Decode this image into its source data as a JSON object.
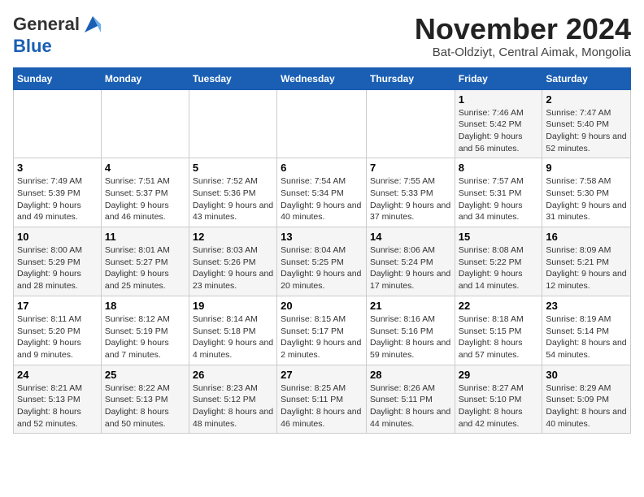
{
  "header": {
    "logo_line1": "General",
    "logo_line2": "Blue",
    "month": "November 2024",
    "location": "Bat-Oldziyt, Central Aimak, Mongolia"
  },
  "weekdays": [
    "Sunday",
    "Monday",
    "Tuesday",
    "Wednesday",
    "Thursday",
    "Friday",
    "Saturday"
  ],
  "weeks": [
    [
      {
        "day": "",
        "detail": ""
      },
      {
        "day": "",
        "detail": ""
      },
      {
        "day": "",
        "detail": ""
      },
      {
        "day": "",
        "detail": ""
      },
      {
        "day": "",
        "detail": ""
      },
      {
        "day": "1",
        "detail": "Sunrise: 7:46 AM\nSunset: 5:42 PM\nDaylight: 9 hours and 56 minutes."
      },
      {
        "day": "2",
        "detail": "Sunrise: 7:47 AM\nSunset: 5:40 PM\nDaylight: 9 hours and 52 minutes."
      }
    ],
    [
      {
        "day": "3",
        "detail": "Sunrise: 7:49 AM\nSunset: 5:39 PM\nDaylight: 9 hours and 49 minutes."
      },
      {
        "day": "4",
        "detail": "Sunrise: 7:51 AM\nSunset: 5:37 PM\nDaylight: 9 hours and 46 minutes."
      },
      {
        "day": "5",
        "detail": "Sunrise: 7:52 AM\nSunset: 5:36 PM\nDaylight: 9 hours and 43 minutes."
      },
      {
        "day": "6",
        "detail": "Sunrise: 7:54 AM\nSunset: 5:34 PM\nDaylight: 9 hours and 40 minutes."
      },
      {
        "day": "7",
        "detail": "Sunrise: 7:55 AM\nSunset: 5:33 PM\nDaylight: 9 hours and 37 minutes."
      },
      {
        "day": "8",
        "detail": "Sunrise: 7:57 AM\nSunset: 5:31 PM\nDaylight: 9 hours and 34 minutes."
      },
      {
        "day": "9",
        "detail": "Sunrise: 7:58 AM\nSunset: 5:30 PM\nDaylight: 9 hours and 31 minutes."
      }
    ],
    [
      {
        "day": "10",
        "detail": "Sunrise: 8:00 AM\nSunset: 5:29 PM\nDaylight: 9 hours and 28 minutes."
      },
      {
        "day": "11",
        "detail": "Sunrise: 8:01 AM\nSunset: 5:27 PM\nDaylight: 9 hours and 25 minutes."
      },
      {
        "day": "12",
        "detail": "Sunrise: 8:03 AM\nSunset: 5:26 PM\nDaylight: 9 hours and 23 minutes."
      },
      {
        "day": "13",
        "detail": "Sunrise: 8:04 AM\nSunset: 5:25 PM\nDaylight: 9 hours and 20 minutes."
      },
      {
        "day": "14",
        "detail": "Sunrise: 8:06 AM\nSunset: 5:24 PM\nDaylight: 9 hours and 17 minutes."
      },
      {
        "day": "15",
        "detail": "Sunrise: 8:08 AM\nSunset: 5:22 PM\nDaylight: 9 hours and 14 minutes."
      },
      {
        "day": "16",
        "detail": "Sunrise: 8:09 AM\nSunset: 5:21 PM\nDaylight: 9 hours and 12 minutes."
      }
    ],
    [
      {
        "day": "17",
        "detail": "Sunrise: 8:11 AM\nSunset: 5:20 PM\nDaylight: 9 hours and 9 minutes."
      },
      {
        "day": "18",
        "detail": "Sunrise: 8:12 AM\nSunset: 5:19 PM\nDaylight: 9 hours and 7 minutes."
      },
      {
        "day": "19",
        "detail": "Sunrise: 8:14 AM\nSunset: 5:18 PM\nDaylight: 9 hours and 4 minutes."
      },
      {
        "day": "20",
        "detail": "Sunrise: 8:15 AM\nSunset: 5:17 PM\nDaylight: 9 hours and 2 minutes."
      },
      {
        "day": "21",
        "detail": "Sunrise: 8:16 AM\nSunset: 5:16 PM\nDaylight: 8 hours and 59 minutes."
      },
      {
        "day": "22",
        "detail": "Sunrise: 8:18 AM\nSunset: 5:15 PM\nDaylight: 8 hours and 57 minutes."
      },
      {
        "day": "23",
        "detail": "Sunrise: 8:19 AM\nSunset: 5:14 PM\nDaylight: 8 hours and 54 minutes."
      }
    ],
    [
      {
        "day": "24",
        "detail": "Sunrise: 8:21 AM\nSunset: 5:13 PM\nDaylight: 8 hours and 52 minutes."
      },
      {
        "day": "25",
        "detail": "Sunrise: 8:22 AM\nSunset: 5:13 PM\nDaylight: 8 hours and 50 minutes."
      },
      {
        "day": "26",
        "detail": "Sunrise: 8:23 AM\nSunset: 5:12 PM\nDaylight: 8 hours and 48 minutes."
      },
      {
        "day": "27",
        "detail": "Sunrise: 8:25 AM\nSunset: 5:11 PM\nDaylight: 8 hours and 46 minutes."
      },
      {
        "day": "28",
        "detail": "Sunrise: 8:26 AM\nSunset: 5:11 PM\nDaylight: 8 hours and 44 minutes."
      },
      {
        "day": "29",
        "detail": "Sunrise: 8:27 AM\nSunset: 5:10 PM\nDaylight: 8 hours and 42 minutes."
      },
      {
        "day": "30",
        "detail": "Sunrise: 8:29 AM\nSunset: 5:09 PM\nDaylight: 8 hours and 40 minutes."
      }
    ]
  ]
}
